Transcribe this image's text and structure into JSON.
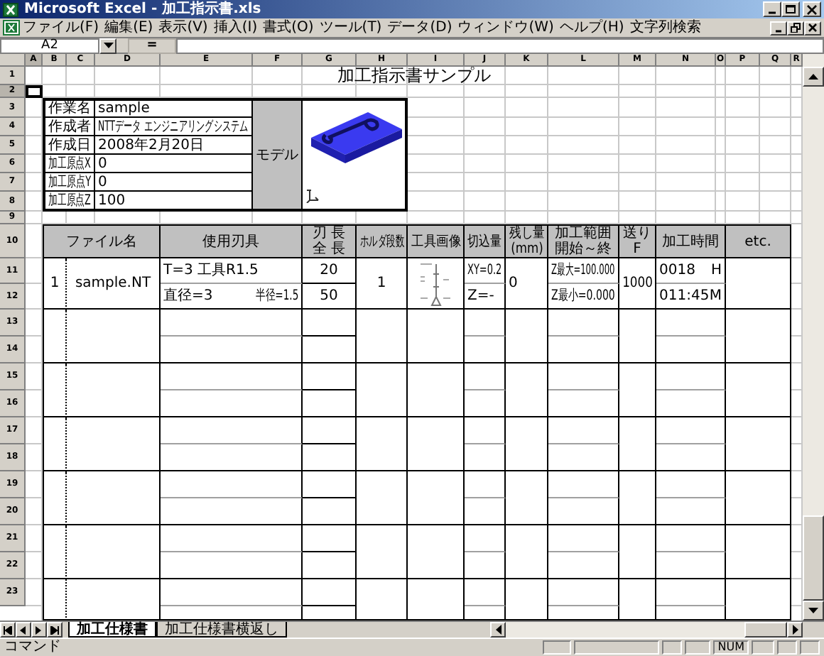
{
  "window": {
    "title": "Microsoft Excel - 加工指示書.xls"
  },
  "menu": [
    "ファイル(F)",
    "編集(E)",
    "表示(V)",
    "挿入(I)",
    "書式(O)",
    "ツール(T)",
    "データ(D)",
    "ウィンドウ(W)",
    "ヘルプ(H)",
    "文字列検索"
  ],
  "name_box": {
    "value": "A2"
  },
  "formula_button": "=",
  "columns": [
    {
      "label": "A",
      "selected": true
    },
    {
      "label": "B",
      "selected": false
    },
    {
      "label": "C",
      "selected": false
    },
    {
      "label": "D",
      "selected": false
    },
    {
      "label": "E",
      "selected": false
    },
    {
      "label": "F",
      "selected": false
    },
    {
      "label": "G",
      "selected": false
    },
    {
      "label": "H",
      "selected": false
    },
    {
      "label": "I",
      "selected": false
    },
    {
      "label": "J",
      "selected": false
    },
    {
      "label": "K",
      "selected": false
    },
    {
      "label": "L",
      "selected": false
    },
    {
      "label": "M",
      "selected": false
    },
    {
      "label": "N",
      "selected": false
    },
    {
      "label": "O",
      "selected": false
    },
    {
      "label": "P",
      "selected": false
    },
    {
      "label": "Q",
      "selected": false
    },
    {
      "label": "R",
      "selected": false
    }
  ],
  "rows": [
    {
      "label": "1",
      "selected": false
    },
    {
      "label": "2",
      "selected": true
    },
    {
      "label": "3",
      "selected": false
    },
    {
      "label": "4",
      "selected": false
    },
    {
      "label": "5",
      "selected": false
    },
    {
      "label": "6",
      "selected": false
    },
    {
      "label": "7",
      "selected": false
    },
    {
      "label": "8",
      "selected": false
    },
    {
      "label": "9",
      "selected": false
    },
    {
      "label": "10",
      "selected": false
    },
    {
      "label": "11",
      "selected": false
    },
    {
      "label": "12",
      "selected": false
    },
    {
      "label": "13",
      "selected": false
    },
    {
      "label": "14",
      "selected": false
    },
    {
      "label": "15",
      "selected": false
    },
    {
      "label": "16",
      "selected": false
    },
    {
      "label": "17",
      "selected": false
    },
    {
      "label": "18",
      "selected": false
    },
    {
      "label": "19",
      "selected": false
    },
    {
      "label": "20",
      "selected": false
    },
    {
      "label": "21",
      "selected": false
    },
    {
      "label": "22",
      "selected": false
    },
    {
      "label": "23",
      "selected": false
    }
  ],
  "sheet": {
    "title": "加工指示書サンプル",
    "info": [
      {
        "label": "作業名",
        "value": "sample"
      },
      {
        "label": "作成者",
        "value": "NTTデータ エンジニアリングシステム"
      },
      {
        "label": "作成日",
        "value": "2008年2月20日"
      },
      {
        "label": "加工原点X",
        "value": "0"
      },
      {
        "label": "加工原点Y",
        "value": "0"
      },
      {
        "label": "加工原点Z",
        "value": "100"
      }
    ],
    "model_label": "モデル",
    "table": {
      "headers": [
        [
          "ファイル名"
        ],
        [
          "使用刃具"
        ],
        [
          "刃 長",
          "全 長"
        ],
        [
          "ホルダ段数"
        ],
        [
          "工具画像"
        ],
        [
          "切込量"
        ],
        [
          "残し量",
          "(mm)"
        ],
        [
          "加工範囲",
          "開始～終"
        ],
        [
          "送り",
          "F"
        ],
        [
          "加工時間"
        ],
        [
          "etc."
        ]
      ],
      "records": [
        {
          "no": "1",
          "file": "sample.NT",
          "tool": "T=3 工具R1.5",
          "diameter": "直径=3",
          "radius": "半径=1.5",
          "lengths": [
            "20",
            "50"
          ],
          "holder_stage": "1",
          "cut": [
            "XY=0.2",
            "Z=-"
          ],
          "stock": "0",
          "range": [
            "Z最大=100.000",
            "Z最小=0.000"
          ],
          "feed": "1000",
          "times": [
            {
              "value": "0018",
              "unit": "H"
            },
            {
              "value": "011:45",
              "unit": "M"
            }
          ]
        }
      ]
    }
  },
  "sheet_tabs": [
    {
      "label": "加工仕様書",
      "selected": true
    },
    {
      "label": "加工仕様書横返し",
      "selected": false
    }
  ],
  "status_bar": {
    "mode": "コマンド",
    "indicators": [
      "NUM"
    ]
  }
}
